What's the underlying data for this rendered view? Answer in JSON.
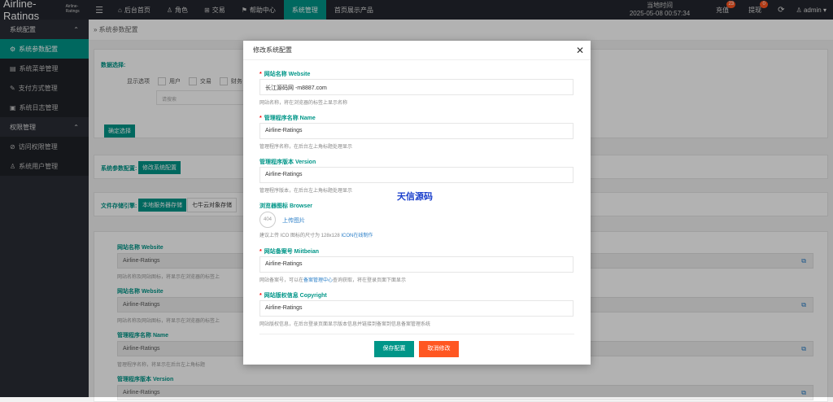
{
  "brand": {
    "main": "Airline-Ratings",
    "sub": "Airline-Ratings"
  },
  "nav": [
    {
      "label": "后台首页",
      "icon": "home-icon",
      "glyph": "⌂"
    },
    {
      "label": "角色",
      "icon": "user-icon",
      "glyph": "♙"
    },
    {
      "label": "交易",
      "icon": "cart-icon",
      "glyph": "⊞"
    },
    {
      "label": "帮助中心",
      "icon": "flag-icon",
      "glyph": "⚑"
    },
    {
      "label": "系统管理",
      "icon": "",
      "glyph": ""
    },
    {
      "label": "首页展示产品",
      "icon": "",
      "glyph": ""
    }
  ],
  "topright": {
    "time_label": "当地时间",
    "time_value": "2025-05-08 00:57:34",
    "recharge_label": "充值",
    "recharge_badge": "23",
    "withdraw_label": "提现",
    "withdraw_badge": "0",
    "user": "admin"
  },
  "sidebar": {
    "groups": [
      {
        "label": "系统配置",
        "items": [
          "系统参数配置",
          "系统菜单管理",
          "支付方式管理",
          "系统日志管理"
        ]
      },
      {
        "label": "权限管理",
        "items": [
          "访问权限管理",
          "系统用户管理"
        ]
      }
    ]
  },
  "breadcrumb": "系统参数配置",
  "background": {
    "data_select_label": "数据选择:",
    "display_options_label": "显示选项",
    "options": [
      "用户",
      "交易",
      "财务"
    ],
    "placeholder": "请搜索",
    "confirm_button": "确定选择",
    "params_label": "系统参数配置:",
    "edit_config_button": "修改系统配置",
    "storage_label": "文件存储引擎:",
    "storage_local": "本地服务器存储",
    "storage_qiniu": "七牛云对象存储",
    "fields": [
      {
        "label": "网站名称 Website",
        "value": "Airline-Ratings",
        "help": "网站名称及网站图标，将显示在浏览器的标签上"
      },
      {
        "label": "网站名称 Website",
        "value": "Airline-Ratings",
        "help": "网站名称及网站图标，将显示在浏览器的标签上"
      },
      {
        "label": "管理程序名称 Name",
        "value": "Airline-Ratings",
        "help": "管理程序名称，将显示在后台左上角标题"
      },
      {
        "label": "管理程序版本 Version",
        "value": "Airline-Ratings",
        "help": ""
      }
    ]
  },
  "modal": {
    "title": "修改系统配置",
    "watermark": "天信源码",
    "fields": {
      "website": {
        "label": "网站名称 Website",
        "value": "长江源码网 -m8887.com",
        "help": "网站名称，将在浏览器的标签上显示名称"
      },
      "name": {
        "label": "管理程序名称 Name",
        "value": "Airline-Ratings",
        "help": "管理程序名称，在后台左上角标题处理显示"
      },
      "version": {
        "label": "管理程序版本 Version",
        "value": "Airline-Ratings",
        "help": "管理程序版本，在后台左上角标题处理显示"
      },
      "browser": {
        "label": "浏览器图标 Browser",
        "icon_text": "404",
        "upload": "上传图片",
        "help_prefix": "建议上传 ICO 图标的尺寸为 128x128",
        "help_link": "ICON在线制作"
      },
      "miitbeian": {
        "label": "网站备案号 Miitbeian",
        "value": "Airline-Ratings",
        "help_prefix": "网站备案号，可以在",
        "help_link": "备案管理中心",
        "help_suffix": "查询获取，将在登录页面下面显示"
      },
      "copyright": {
        "label": "网站版权信息 Copyright",
        "value": "Airline-Ratings",
        "help": "网站版权信息，在后台登录页面显示版本信息并链接到备案到信息备案管理系统"
      }
    },
    "save_button": "保存配置",
    "cancel_button": "取消修改"
  }
}
